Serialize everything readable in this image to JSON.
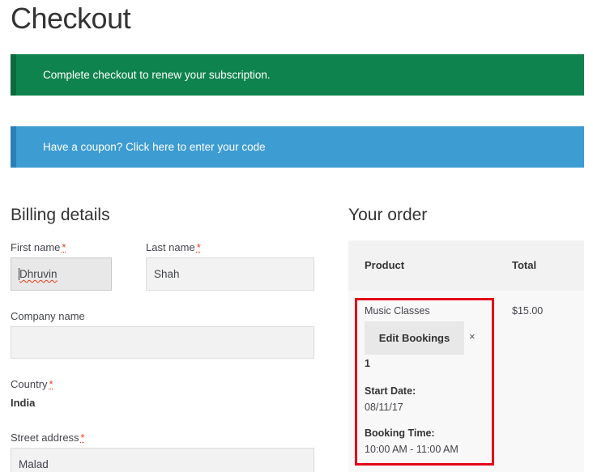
{
  "page": {
    "title": "Checkout"
  },
  "notices": {
    "renew": "Complete checkout to renew your subscription.",
    "coupon": "Have a coupon? Click here to enter your code"
  },
  "billing": {
    "title": "Billing details",
    "first_name_label": "First name",
    "first_name_value": "Dhruvin",
    "last_name_label": "Last name",
    "last_name_value": "Shah",
    "company_label": "Company name",
    "company_value": "",
    "country_label": "Country",
    "country_value": "India",
    "street_label": "Street address",
    "street_value": "Malad",
    "required_mark": "*"
  },
  "order": {
    "title": "Your order",
    "col_product": "Product",
    "col_total": "Total",
    "item_name": "Music Classes",
    "item_total": "$15.00",
    "edit_button": "Edit Bookings",
    "remove": "×",
    "quantity": "1",
    "start_date_label": "Start Date:",
    "start_date_value": "08/11/17",
    "booking_time_label": "Booking Time:",
    "booking_time_value": "10:00 AM - 11:00 AM"
  },
  "colors": {
    "success": "#0f834d",
    "info": "#3d9cd2",
    "highlight": "#e3061a",
    "required": "#e2401c"
  }
}
